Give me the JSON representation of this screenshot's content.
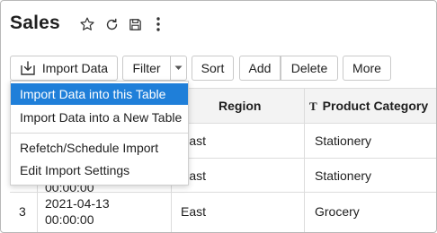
{
  "header": {
    "title": "Sales",
    "icons": [
      "star-icon",
      "refresh-icon",
      "save-icon",
      "more-vertical-icon"
    ]
  },
  "toolbar": {
    "import_label": "Import Data",
    "filter_label": "Filter",
    "sort_label": "Sort",
    "add_label": "Add",
    "delete_label": "Delete",
    "more_label": "More"
  },
  "import_menu": {
    "items": [
      {
        "label": "Import Data into this Table",
        "highlighted": true
      },
      {
        "label": "Import Data into a New Table",
        "highlighted": false
      },
      {
        "label": "Refetch/Schedule Import",
        "highlighted": false
      },
      {
        "label": "Edit Import Settings",
        "highlighted": false
      }
    ]
  },
  "table": {
    "columns": [
      {
        "label": "Region",
        "type_icon": null
      },
      {
        "label": "Product Category",
        "type_icon": "T"
      }
    ],
    "rows": [
      {
        "num": "",
        "date": "",
        "region": "East",
        "category": "Stationery"
      },
      {
        "num": "",
        "date": "00:00:00",
        "region": "East",
        "category": "Stationery"
      },
      {
        "num": "3",
        "date": "2021-04-13",
        "time": "00:00:00",
        "region": "East",
        "category": "Grocery"
      }
    ]
  },
  "colors": {
    "menu_highlight": "#1f7fd9",
    "header_bg": "#f3f3f3",
    "border": "#dcdcdc"
  }
}
